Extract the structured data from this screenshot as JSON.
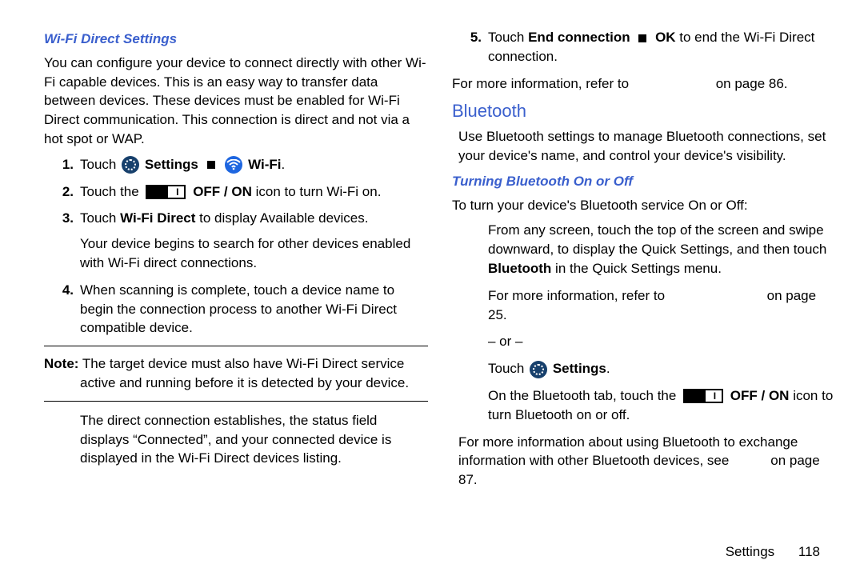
{
  "left": {
    "heading": "Wi-Fi Direct Settings",
    "intro": "You can configure your device to connect directly with other Wi-Fi capable devices. This is an easy way to transfer data between devices. These devices must be enabled for Wi-Fi Direct communication. This connection is direct and not via a hot spot or WAP.",
    "step1_pre": "Touch ",
    "step1_settings": "Settings",
    "step1_wifi": "Wi-Fi",
    "step1_post": ".",
    "step2_pre": "Touch the ",
    "step2_bold": "OFF / ON",
    "step2_post": " icon to turn Wi-Fi on.",
    "step3_pre": "Touch ",
    "step3_bold": "Wi-Fi Direct",
    "step3_post": " to display Available devices.",
    "step3_sub": "Your device begins to search for other devices enabled with Wi-Fi direct connections.",
    "step4": "When scanning is complete, touch a device name to begin the connection process to another Wi-Fi Direct compatible device.",
    "note_label": "Note:",
    "note_text": " The target device must also have Wi-Fi Direct service active and running before it is detected by your device.",
    "after_note": "The direct connection establishes, the status field displays “Connected”, and your connected device is displayed in the Wi-Fi Direct devices listing."
  },
  "right": {
    "step5_pre": "Touch ",
    "step5_bold1": "End connection",
    "step5_bold2": "OK",
    "step5_post": " to end the Wi-Fi Direct connection.",
    "xref1_pre": "For more information, refer to ",
    "xref1_post": " on page 86.",
    "bt_heading": "Bluetooth",
    "bt_intro": "Use Bluetooth settings to manage Bluetooth connections, set your device's name, and control your device's visibility.",
    "bt_sub_heading": "Turning Bluetooth On or Off",
    "bt_turn_intro": "To turn your device's Bluetooth service On or Off:",
    "bt_swipe": "From any screen, touch the top of the screen and swipe downward, to display the Quick Settings, and then touch ",
    "bt_swipe_bold": "Bluetooth",
    "bt_swipe_post": " in the Quick Settings menu.",
    "bt_xref2_pre": "For more information, refer to ",
    "bt_xref2_post": " on page 25.",
    "or": "– or –",
    "touch_settings_pre": "Touch ",
    "touch_settings_bold": "Settings",
    "touch_settings_post": ".",
    "bt_tab_pre": "On the Bluetooth tab, touch the ",
    "bt_tab_bold": "OFF / ON",
    "bt_tab_post": " icon to turn Bluetooth on or off.",
    "bt_more_pre": "For more information about using Bluetooth to exchange information with other Bluetooth devices, see ",
    "bt_more_post": " on page 87."
  },
  "footer": {
    "section": "Settings",
    "page": "118"
  }
}
